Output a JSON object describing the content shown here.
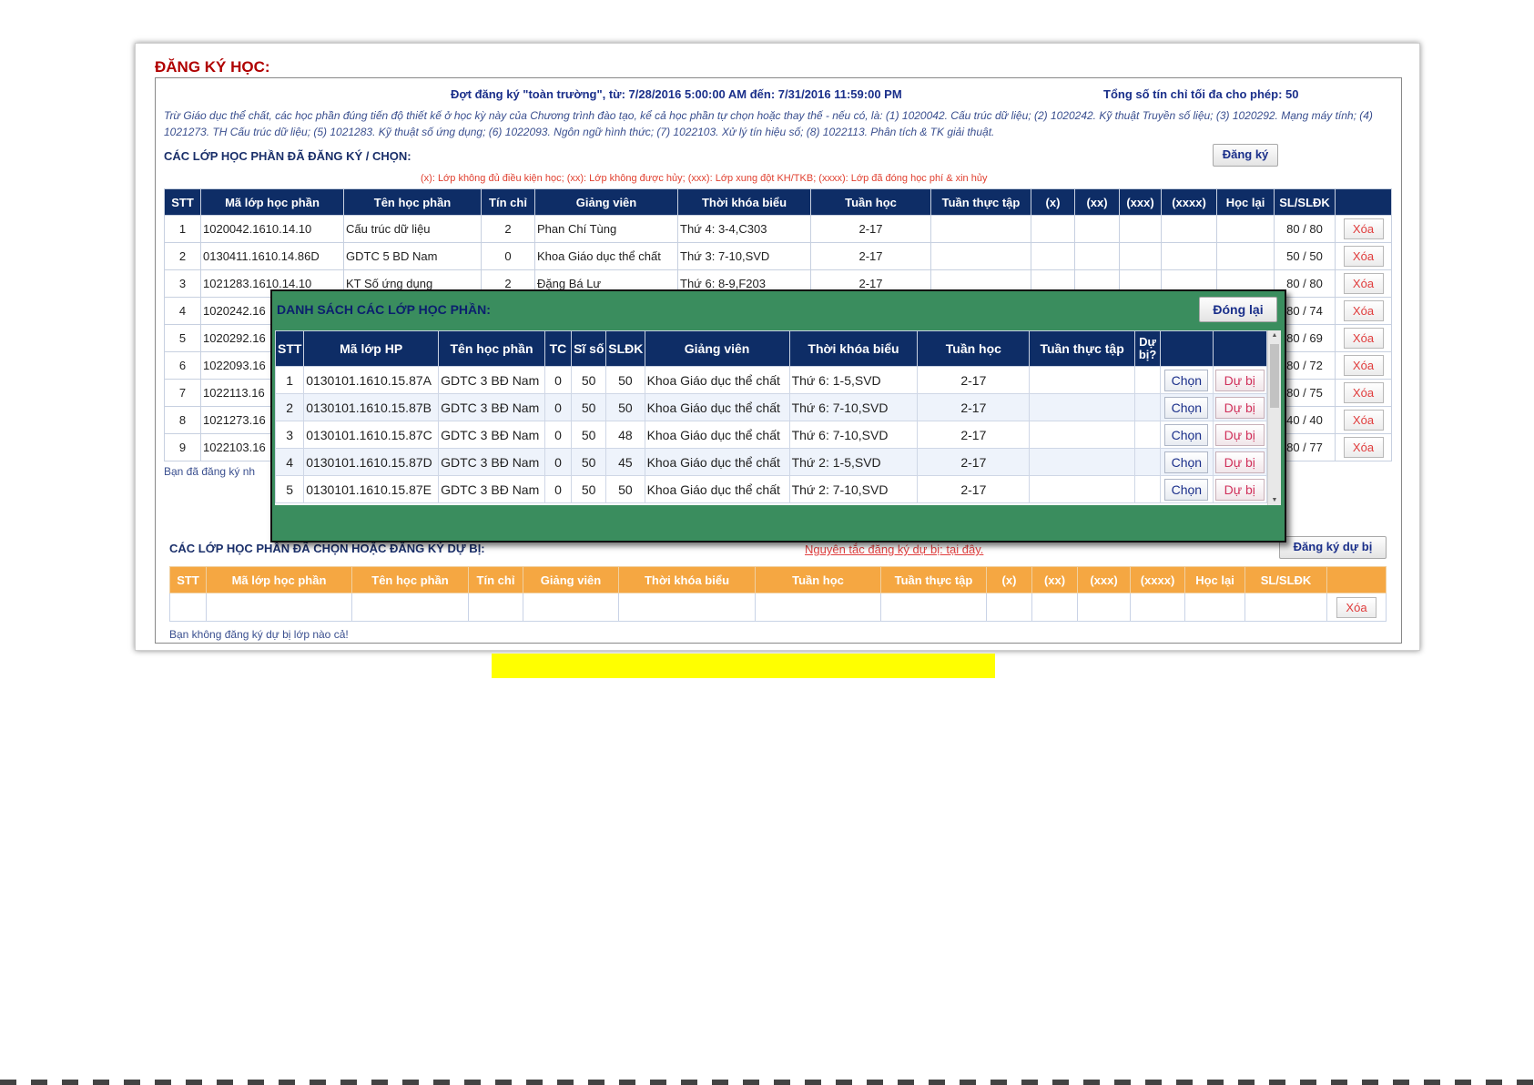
{
  "page": {
    "title": "ĐĂNG KÝ HỌC:",
    "round_info": "Đợt đăng ký \"toàn trường\", từ: 7/28/2016 5:00:00 AM đến: 7/31/2016 11:59:00 PM",
    "max_credits": "Tổng số tín chỉ tối đa cho phép: 50",
    "note": "Trừ Giáo dục thể chất, các học phần đúng tiến độ thiết kế ở học kỳ này của Chương trình đào tạo, kể cả học phần tự chọn hoặc thay thế - nếu có, là: (1) 1020042. Cấu trúc dữ liệu; (2) 1020242. Kỹ thuật Truyền số liệu; (3) 1020292. Mạng máy tính; (4) 1021273. TH Cấu trúc dữ liệu; (5) 1021283. Kỹ thuật số ứng dụng; (6) 1022093. Ngôn ngữ hình thức; (7) 1022103. Xử lý tín hiệu số; (8) 1022113. Phân tích & TK giải thuật."
  },
  "registered": {
    "title": "CÁC LỚP HỌC PHẦN ĐÃ ĐĂNG KÝ / CHỌN:",
    "register_button": "Đăng ký",
    "legend": "(x): Lớp không đủ điều kiện học; (xx): Lớp không được hủy; (xxx): Lớp xung đột KH/TKB; (xxxx): Lớp đã đóng học phí & xin hủy",
    "headers": [
      "STT",
      "Mã lớp học phần",
      "Tên học phần",
      "Tín chỉ",
      "Giảng viên",
      "Thời khóa biểu",
      "Tuần học",
      "Tuần thực tập",
      "(x)",
      "(xx)",
      "(xxx)",
      "(xxxx)",
      "Học lại",
      "SL/SLĐK"
    ],
    "delete_label": "Xóa",
    "rows": [
      {
        "stt": "1",
        "code": "1020042.1610.14.10",
        "name": "Cấu trúc dữ liệu",
        "credits": "2",
        "lecturer": "Phan Chí Tùng",
        "schedule": "Thứ 4: 3-4,C303",
        "weeks": "2-17",
        "sl": "80 / 80"
      },
      {
        "stt": "2",
        "code": "0130411.1610.14.86D",
        "name": "GDTC 5 BD Nam",
        "credits": "0",
        "lecturer": "Khoa Giáo dục thể chất",
        "schedule": "Thứ 3: 7-10,SVD",
        "weeks": "2-17",
        "sl": "50 / 50"
      },
      {
        "stt": "3",
        "code": "1021283.1610.14.10",
        "name": "KT Số ứng dụng",
        "credits": "2",
        "lecturer": "Đặng Bá Lư",
        "schedule": "Thứ 6: 8-9,F203",
        "weeks": "2-17",
        "sl": "80 / 80"
      },
      {
        "stt": "4",
        "code": "1020242.16",
        "name": "",
        "credits": "",
        "lecturer": "",
        "schedule": "",
        "weeks": "",
        "sl": "80 / 74"
      },
      {
        "stt": "5",
        "code": "1020292.16",
        "name": "",
        "credits": "",
        "lecturer": "",
        "schedule": "",
        "weeks": "",
        "sl": "80 / 69"
      },
      {
        "stt": "6",
        "code": "1022093.16",
        "name": "",
        "credits": "",
        "lecturer": "",
        "schedule": "",
        "weeks": "",
        "sl": "80 / 72"
      },
      {
        "stt": "7",
        "code": "1022113.16",
        "name": "",
        "credits": "",
        "lecturer": "",
        "schedule": "",
        "weeks": "",
        "sl": "80 / 75"
      },
      {
        "stt": "8",
        "code": "1021273.16",
        "name": "",
        "credits": "",
        "lecturer": "",
        "schedule": "",
        "weeks": "",
        "sl": "40 / 40"
      },
      {
        "stt": "9",
        "code": "1022103.16",
        "name": "",
        "credits": "",
        "lecturer": "",
        "schedule": "",
        "weeks": "",
        "sl": "80 / 77"
      }
    ],
    "status": "Bạn đã đăng ký nh"
  },
  "reserve": {
    "title": "CÁC LỚP HỌC PHẦN ĐÃ CHỌN HOẶC ĐĂNG KÝ DỰ BỊ:",
    "rule_link": "Nguyên tắc đăng ký dự bị: tại đây.",
    "register_button": "Đăng ký dự bị",
    "headers": [
      "STT",
      "Mã lớp học phần",
      "Tên học phần",
      "Tín chỉ",
      "Giảng viên",
      "Thời khóa biểu",
      "Tuần học",
      "Tuần thực tập",
      "(x)",
      "(xx)",
      "(xxx)",
      "(xxxx)",
      "Học lại",
      "SL/SLĐK"
    ],
    "delete_label": "Xóa",
    "status": "Bạn không đăng ký dự bị lớp nào cả!"
  },
  "modal": {
    "title": "DANH SÁCH CÁC LỚP HỌC PHẦN:",
    "close_button": "Đóng lại",
    "headers": [
      "STT",
      "Mã lớp HP",
      "Tên học phần",
      "TC",
      "Sĩ số",
      "SLĐK",
      "Giảng viên",
      "Thời khóa biểu",
      "Tuần học",
      "Tuần thực tập",
      "Dự bị?"
    ],
    "choose_label": "Chọn",
    "reserve_label": "Dự bị",
    "rows": [
      {
        "stt": "1",
        "code": "0130101.1610.15.87A",
        "name": "GDTC 3 BĐ Nam",
        "tc": "0",
        "size": "50",
        "reg": "50",
        "lecturer": "Khoa Giáo dục thể chất",
        "schedule": "Thứ 6: 1-5,SVD",
        "weeks": "2-17"
      },
      {
        "stt": "2",
        "code": "0130101.1610.15.87B",
        "name": "GDTC 3 BĐ Nam",
        "tc": "0",
        "size": "50",
        "reg": "50",
        "lecturer": "Khoa Giáo dục thể chất",
        "schedule": "Thứ 6: 7-10,SVD",
        "weeks": "2-17"
      },
      {
        "stt": "3",
        "code": "0130101.1610.15.87C",
        "name": "GDTC 3 BĐ Nam",
        "tc": "0",
        "size": "50",
        "reg": "48",
        "lecturer": "Khoa Giáo dục thể chất",
        "schedule": "Thứ 6: 7-10,SVD",
        "weeks": "2-17"
      },
      {
        "stt": "4",
        "code": "0130101.1610.15.87D",
        "name": "GDTC 3 BĐ Nam",
        "tc": "0",
        "size": "50",
        "reg": "45",
        "lecturer": "Khoa Giáo dục thể chất",
        "schedule": "Thứ 2: 1-5,SVD",
        "weeks": "2-17"
      },
      {
        "stt": "5",
        "code": "0130101.1610.15.87E",
        "name": "GDTC 3 BĐ Nam",
        "tc": "0",
        "size": "50",
        "reg": "50",
        "lecturer": "Khoa Giáo dục thể chất",
        "schedule": "Thứ 2: 7-10,SVD",
        "weeks": "2-17"
      }
    ]
  },
  "colors": {
    "header_navy": "#0e2d66",
    "header_orange": "#f5a742",
    "modal_green": "#3a8d5e",
    "title_red": "#b00000",
    "highlight_yellow": "#ffff00"
  }
}
